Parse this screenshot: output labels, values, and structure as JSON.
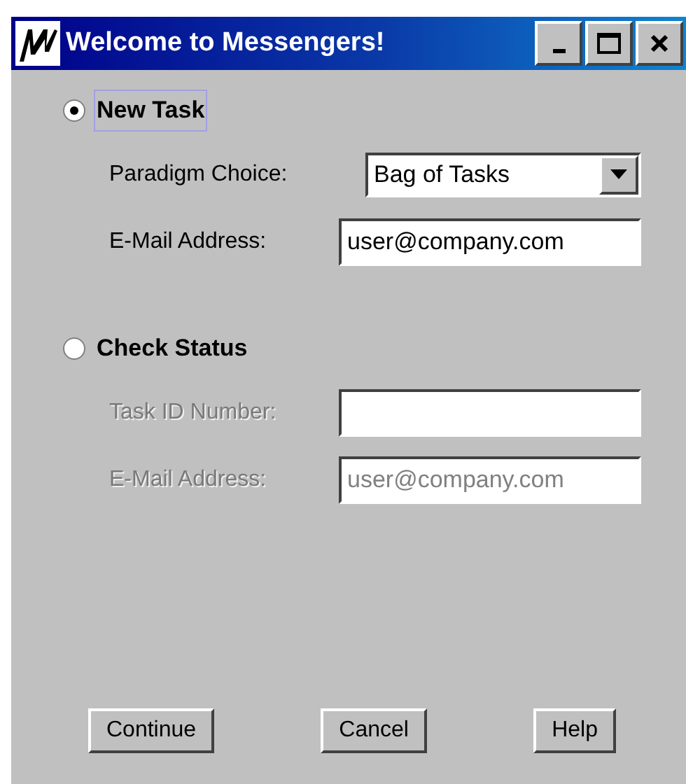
{
  "window": {
    "title": "Welcome to Messengers!"
  },
  "options": [
    {
      "label": "New Task",
      "selected": true,
      "focused": true,
      "fields": [
        {
          "kind": "dropdown",
          "label": "Paradigm Choice:",
          "value": "Bag of Tasks"
        },
        {
          "kind": "text",
          "label": "E-Mail Address:",
          "value": "user@company.com"
        }
      ]
    },
    {
      "label": "Check Status",
      "selected": false,
      "focused": false,
      "fields": [
        {
          "kind": "text",
          "label": "Task ID Number:"
        },
        {
          "kind": "text",
          "label": "E-Mail Address:",
          "value": "user@company.com"
        }
      ]
    }
  ],
  "buttons": [
    "Continue",
    "Cancel",
    "Help"
  ]
}
